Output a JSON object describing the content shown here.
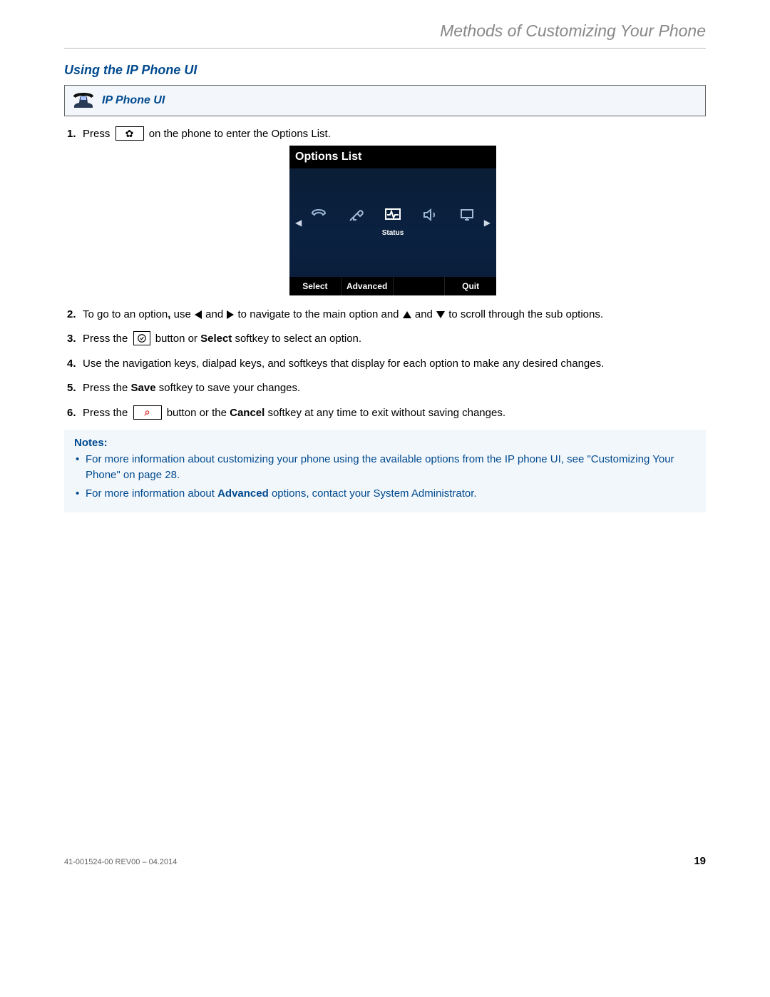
{
  "header": {
    "breadcrumb": "Methods of Customizing Your Phone"
  },
  "section": {
    "title": "Using the IP Phone UI"
  },
  "banner": {
    "label": "IP Phone UI"
  },
  "screenshot": {
    "title": "Options List",
    "status_label": "Status",
    "softkeys": {
      "select": "Select",
      "advanced": "Advanced",
      "quit": "Quit"
    }
  },
  "steps": {
    "s1a": "Press ",
    "s1b": " on the phone to enter the Options List.",
    "s2a": "To go to an option",
    "s2comma": ",",
    "s2b": " use ",
    "s2c": " and ",
    "s2d": " to navigate to the main option and ",
    "s2e": " and ",
    "s2f": " to scroll through the sub options.",
    "s3a": "Press the ",
    "s3b": " button or ",
    "s3bold": "Select",
    "s3c": " softkey to select an option.",
    "s4": "Use the navigation keys, dialpad keys, and softkeys that display for each option to make any desired changes.",
    "s5a": "Press the ",
    "s5bold": "Save",
    "s5b": " softkey to save your changes.",
    "s6a": "Press the ",
    "s6b": " button or the ",
    "s6bold": "Cancel",
    "s6c": " softkey at any time to exit without saving changes."
  },
  "notes": {
    "title": "Notes:",
    "n1a": "For more information about customizing your phone using the available options from the IP phone UI, see ",
    "n1link": "\"Customizing Your Phone\"",
    "n1b": " on ",
    "n1page": "page 28",
    "n1end": ".",
    "n2a": "For more information about ",
    "n2bold": "Advanced",
    "n2b": " options, contact your System Administrator."
  },
  "footer": {
    "docid": "41-001524-00 REV00 – 04.2014",
    "page": "19"
  }
}
